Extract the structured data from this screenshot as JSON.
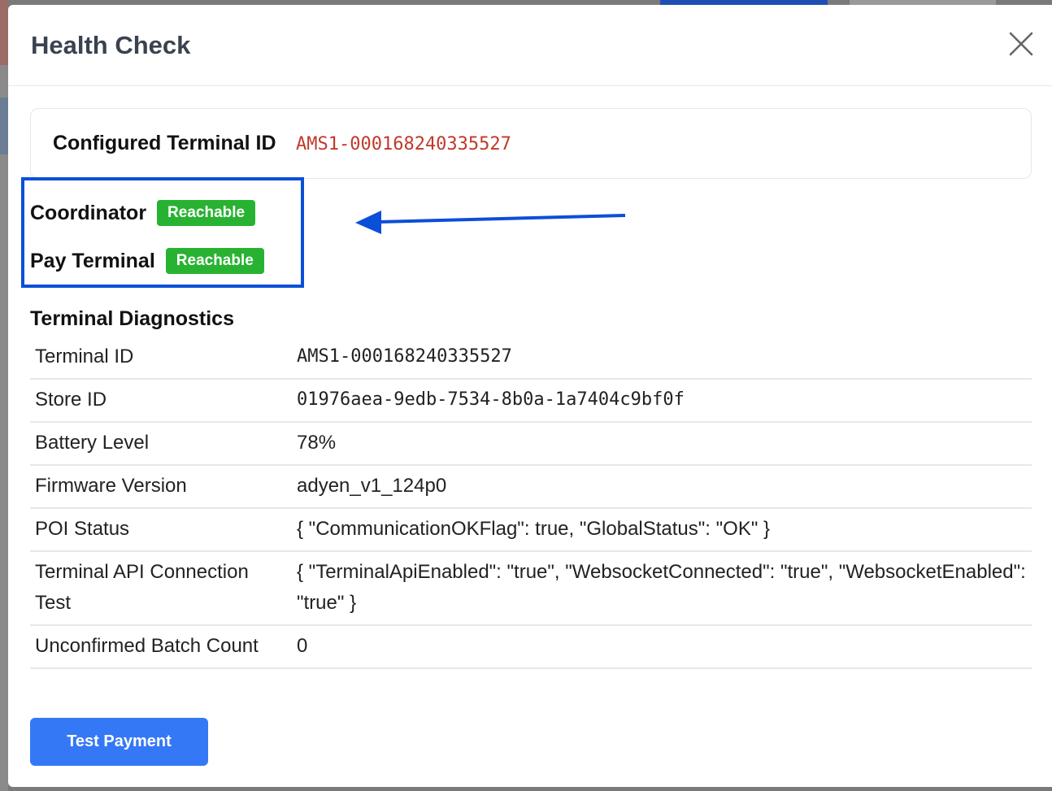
{
  "modal": {
    "title": "Health Check"
  },
  "configured": {
    "label": "Configured Terminal ID",
    "value": "AMS1-000168240335527"
  },
  "reachability": [
    {
      "label": "Coordinator",
      "status": "Reachable"
    },
    {
      "label": "Pay Terminal",
      "status": "Reachable"
    }
  ],
  "diagnostics": {
    "title": "Terminal Diagnostics",
    "rows": [
      {
        "key": "Terminal ID",
        "value": "AMS1-000168240335527"
      },
      {
        "key": "Store ID",
        "value": "01976aea-9edb-7534-8b0a-1a7404c9bf0f"
      },
      {
        "key": "Battery Level",
        "value": "78%"
      },
      {
        "key": "Firmware Version",
        "value": "adyen_v1_124p0"
      },
      {
        "key": "POI Status",
        "value": "{ \"CommunicationOKFlag\": true, \"GlobalStatus\": \"OK\" }"
      },
      {
        "key": "Terminal API Connection Test",
        "value": "{ \"TerminalApiEnabled\": \"true\", \"WebsocketConnected\": \"true\", \"WebsocketEnabled\": \"true\" }"
      },
      {
        "key": "Unconfirmed Batch Count",
        "value": "0"
      }
    ]
  },
  "actions": {
    "test_payment_label": "Test Payment"
  },
  "colors": {
    "badge_green": "#28b232",
    "primary_blue": "#3478f6",
    "annotation_blue": "#0a4fd8",
    "mono_red": "#c0392b"
  },
  "icons": {
    "close": "close-icon",
    "annotation_arrow": "arrow-left-icon"
  }
}
